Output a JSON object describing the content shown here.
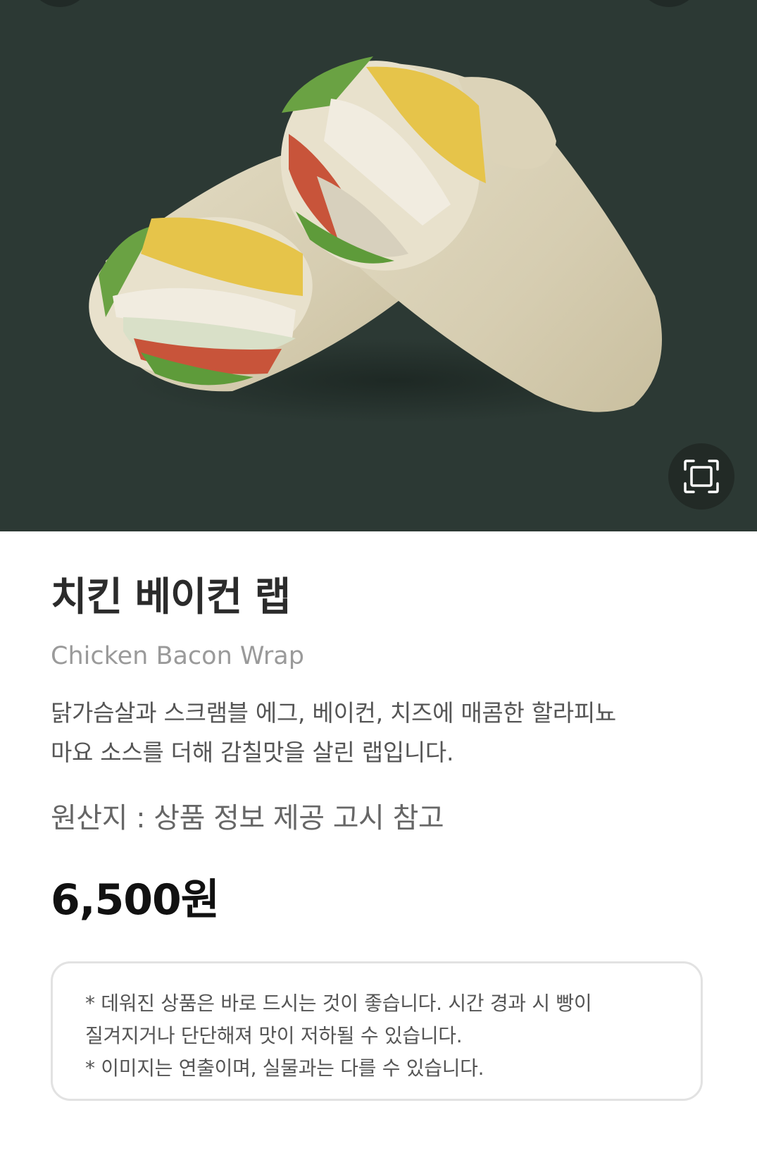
{
  "product": {
    "name_ko": "치킨 베이컨 랩",
    "name_en": "Chicken Bacon Wrap",
    "description_lines": [
      "닭가슴살과 스크램블 에그, 베이컨, 치즈에 매콤한 할라피뇨",
      "마요 소스를 더해 감칠맛을 살린 랩입니다."
    ],
    "origin": "원산지 : 상품 정보 제공 고시 참고",
    "price": "6,500원"
  },
  "notice": {
    "lines": [
      "* 데워진 상품은 바로 드시는 것이 좋습니다. 시간 경과 시 빵이",
      "질겨지거나 단단해져 맛이 저하될 수 있습니다.",
      "* 이미지는 연출이며, 실물과는 다를 수 있습니다."
    ]
  },
  "icons": {
    "expand": "fullscreen-icon"
  },
  "colors": {
    "hero_background": "#2c3934",
    "price": "#111111",
    "subtitle": "#9a9a9a"
  }
}
